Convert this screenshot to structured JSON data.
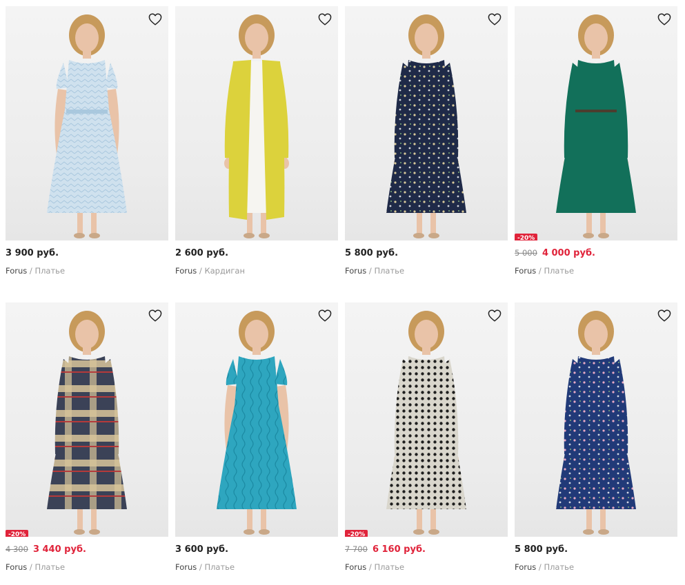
{
  "products": [
    {
      "brand": "Forus",
      "category": "Платье",
      "price": "3 900 руб.",
      "old_price": "",
      "discount": "",
      "on_sale": false,
      "dress_color": "#cfe1ee",
      "pattern": "chevron",
      "accent": "#a9c8de",
      "sleeve": "short"
    },
    {
      "brand": "Forus",
      "category": "Кардиган",
      "price": "2 600 руб.",
      "old_price": "",
      "discount": "",
      "on_sale": false,
      "dress_color": "#dcd23c",
      "pattern": "cardigan",
      "accent": "#f4f4f0",
      "sleeve": "long"
    },
    {
      "brand": "Forus",
      "category": "Платье",
      "price": "5 800 руб.",
      "old_price": "",
      "discount": "",
      "on_sale": false,
      "dress_color": "#1f2a48",
      "pattern": "floral",
      "accent": "#d9c99a",
      "sleeve": "long"
    },
    {
      "brand": "Forus",
      "category": "Платье",
      "price": "4 000 руб.",
      "old_price": "5 000",
      "discount": "-20%",
      "on_sale": true,
      "dress_color": "#12705a",
      "pattern": "plain",
      "accent": "#4b3d2e",
      "sleeve": "long"
    },
    {
      "brand": "Forus",
      "category": "Платье",
      "price": "3 440 руб.",
      "old_price": "4 300",
      "discount": "-20%",
      "on_sale": true,
      "dress_color": "#3b4257",
      "pattern": "plaid",
      "accent": "#d8c59a",
      "sleeve": "long"
    },
    {
      "brand": "Forus",
      "category": "Платье",
      "price": "3 600 руб.",
      "old_price": "",
      "discount": "",
      "on_sale": false,
      "dress_color": "#2ea6bf",
      "pattern": "waves",
      "accent": "#1b8aa3",
      "sleeve": "short"
    },
    {
      "brand": "Forus",
      "category": "Платье",
      "price": "6 160 руб.",
      "old_price": "7 700",
      "discount": "-20%",
      "on_sale": true,
      "dress_color": "#d9d6cc",
      "pattern": "dots",
      "accent": "#1e1e1e",
      "sleeve": "long"
    },
    {
      "brand": "Forus",
      "category": "Платье",
      "price": "5 800 руб.",
      "old_price": "",
      "discount": "",
      "on_sale": false,
      "dress_color": "#213a78",
      "pattern": "floral",
      "accent": "#e8a9c4",
      "sleeve": "long"
    }
  ],
  "separator": "/",
  "icons": {
    "favorite": "heart-outline-icon"
  },
  "colors": {
    "sale_red": "#e0233a",
    "price_text": "#222222",
    "muted": "#999999"
  }
}
